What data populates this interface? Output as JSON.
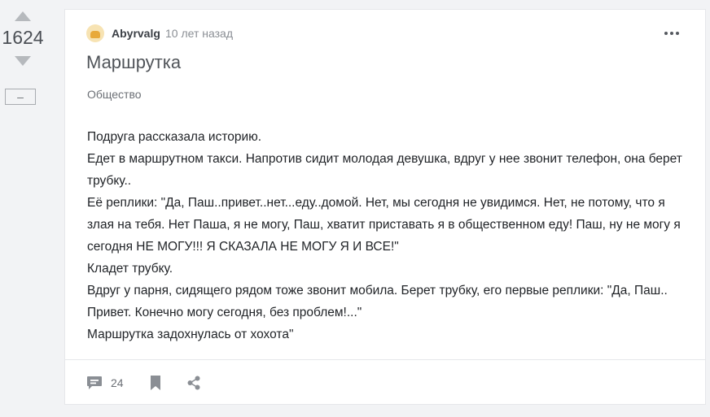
{
  "vote": {
    "rating": "1624",
    "collapse_label": "–"
  },
  "post": {
    "author": "Abyrvalg",
    "time": "10 лет назад",
    "title": "Маршрутка",
    "tag": "Общество",
    "lines": [
      "Подруга рассказала историю.",
      "Едет в маршрутном такси. Напротив сидит молодая девушка, вдруг у нее звонит телефон, она берет трубку..",
      "Её реплики: \"Да, Паш..привет..нет...еду..домой. Нет, мы сегодня не увидимся. Нет, не потому, что я злая на тебя. Нет Паша, я не могу, Паш, хватит приставать я в общественном еду! Паш, ну не могу я сегодня НЕ МОГУ!!! Я СКАЗАЛА НЕ МОГУ Я И ВСЕ!\"",
      "Кладет трубку.",
      "Вдруг у парня, сидящего рядом тоже звонит мобила. Берет трубку, его первые реплики: \"Да, Паш.. Привет. Конечно могу сегодня, без проблем!...\"",
      "Маршрутка задохнулась от хохота\""
    ]
  },
  "footer": {
    "comments_count": "24"
  },
  "icons": {
    "comment": "comment-icon",
    "save": "bookmark-icon",
    "share": "share-icon",
    "more": "more-dots-icon"
  },
  "colors": {
    "icon": "#8a8e94",
    "vote_arrow": "#b6b9bd",
    "card_bg": "#ffffff",
    "page_bg": "#f2f3f5"
  }
}
